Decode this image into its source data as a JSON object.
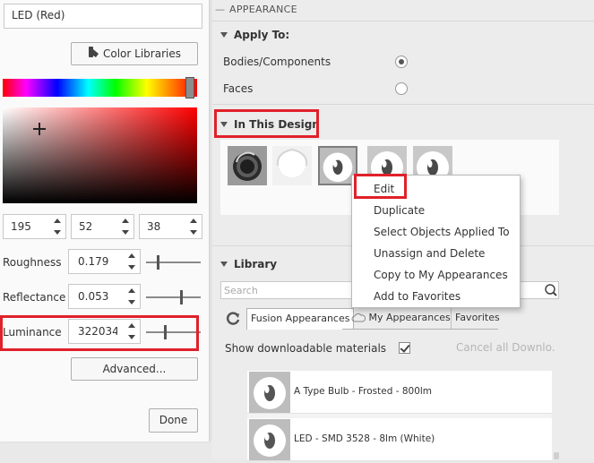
{
  "editor": {
    "name_value": "LED (Red)",
    "color_libraries_label": "Color Libraries",
    "rgb": {
      "r": "195",
      "g": "52",
      "b": "38"
    },
    "current_color": "#c33426",
    "properties": [
      {
        "label": "Roughness",
        "value": "0.179",
        "slider_fraction": 0.2
      },
      {
        "label": "Reflectance",
        "value": "0.053",
        "slider_fraction": 0.65
      },
      {
        "label": "Luminance",
        "value": "322034",
        "slider_fraction": 0.35
      }
    ],
    "advanced_label": "Advanced...",
    "done_label": "Done"
  },
  "appearance": {
    "panel_title": "APPEARANCE",
    "apply_to": {
      "heading": "Apply To:",
      "options": [
        {
          "label": "Bodies/Components",
          "selected": true
        },
        {
          "label": "Faces",
          "selected": false
        }
      ]
    },
    "in_design": {
      "heading": "In This Design",
      "thumbnail_count": 5
    },
    "library": {
      "heading": "Library",
      "search_placeholder": "Search",
      "tabs": [
        "Fusion Appearances",
        "My Appearances",
        "Favorites"
      ],
      "show_downloadable_label": "Show downloadable materials",
      "show_downloadable_checked": true,
      "cancel_label": "Cancel all Downlo...",
      "items": [
        {
          "name": "A Type Bulb - Frosted - 800lm"
        },
        {
          "name": "LED - SMD 3528 - 8lm (White)"
        }
      ]
    }
  },
  "context_menu": {
    "items": [
      "Edit",
      "Duplicate",
      "Select Objects Applied To",
      "Unassign and Delete",
      "Copy to My Appearances",
      "Add to Favorites"
    ]
  },
  "colors": {
    "highlight_red": "#e0202a",
    "panel_bg": "#ececec"
  }
}
